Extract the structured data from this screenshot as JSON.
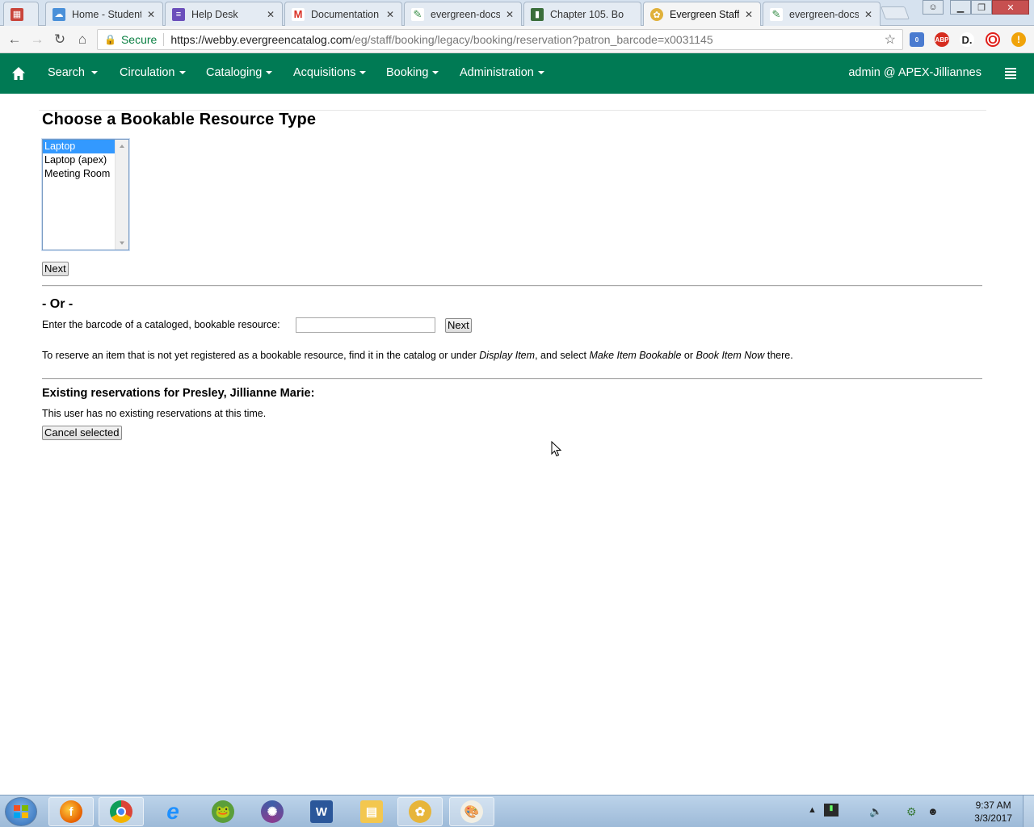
{
  "browser": {
    "tabs": [
      {
        "title": "",
        "icon": "apps-icon",
        "active": false
      },
      {
        "title": "Home - Student",
        "icon": "cloud-icon",
        "active": false
      },
      {
        "title": "Help Desk",
        "icon": "form-icon",
        "active": false
      },
      {
        "title": "Documentation",
        "icon": "gmail-icon",
        "active": false
      },
      {
        "title": "evergreen-docs:",
        "icon": "pencil-icon",
        "active": false
      },
      {
        "title": "Chapter 105. Bo",
        "icon": "book-icon",
        "active": false
      },
      {
        "title": "Evergreen Staff",
        "icon": "evergreen-icon",
        "active": true
      },
      {
        "title": "evergreen-docs:",
        "icon": "pencil-icon",
        "active": false
      }
    ],
    "secure_label": "Secure",
    "url_host": "https://webby.evergreencatalog.com",
    "url_path": "/eg/staff/booking/legacy/booking/reservation?patron_barcode=x0031145",
    "extension_badge": "0",
    "abp_label": "ABP"
  },
  "navbar": {
    "items": [
      {
        "label": "Search"
      },
      {
        "label": "Circulation"
      },
      {
        "label": "Cataloging"
      },
      {
        "label": "Acquisitions"
      },
      {
        "label": "Booking"
      },
      {
        "label": "Administration"
      }
    ],
    "user": "admin @ APEX-Jilliannes"
  },
  "page": {
    "title": "Choose a Bookable Resource Type",
    "resource_types": [
      "Laptop",
      "Laptop (apex)",
      "Meeting Room"
    ],
    "selected_index": 0,
    "next_label": "Next",
    "or_label": "- Or -",
    "barcode_label": "Enter the barcode of a cataloged, bookable resource:",
    "barcode_value": "",
    "barcode_next_label": "Next",
    "hint": {
      "prefix": "To reserve an item that is not yet registered as a bookable resource, find it in the catalog or under ",
      "em1": "Display Item",
      "mid1": ", and select ",
      "em2": "Make Item Bookable",
      "mid2": " or ",
      "em3": "Book Item Now",
      "suffix": " there."
    },
    "existing_title": "Existing reservations for Presley, Jillianne Marie:",
    "no_reservations": "This user has no existing reservations at this time.",
    "cancel_label": "Cancel selected"
  },
  "taskbar": {
    "apps": [
      "firefox-icon",
      "chrome-icon",
      "ie-icon",
      "frog-icon",
      "swirl-icon",
      "word-icon",
      "explorer-icon",
      "evergreen-icon",
      "paint-icon"
    ],
    "time": "9:37 AM",
    "date": "3/3/2017"
  },
  "colors": {
    "navbar": "#007a54",
    "selection": "#3399ff",
    "secure": "#0b8043"
  }
}
